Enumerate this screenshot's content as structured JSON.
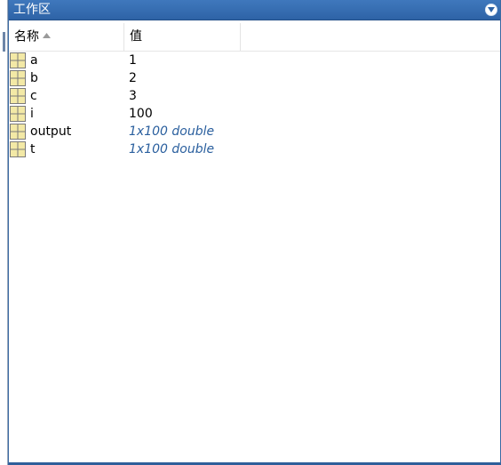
{
  "panel": {
    "title": "工作区",
    "menu_icon": "dropdown-circle-icon"
  },
  "columns": {
    "name": "名称",
    "value": "值",
    "sort_icon": "sort-ascending-icon"
  },
  "variables": [
    {
      "name": "a",
      "value": "1",
      "italic": false
    },
    {
      "name": "b",
      "value": "2",
      "italic": false
    },
    {
      "name": "c",
      "value": "3",
      "italic": false
    },
    {
      "name": "i",
      "value": "100",
      "italic": false
    },
    {
      "name": "output",
      "value": "1x100 double",
      "italic": true
    },
    {
      "name": "t",
      "value": "1x100 double",
      "italic": true
    }
  ],
  "colors": {
    "titlebar": "#3a72b6",
    "matrix_value": "#2a5f9e",
    "icon_fill": "#f3e9a6",
    "icon_grid": "#7b7b7b"
  }
}
